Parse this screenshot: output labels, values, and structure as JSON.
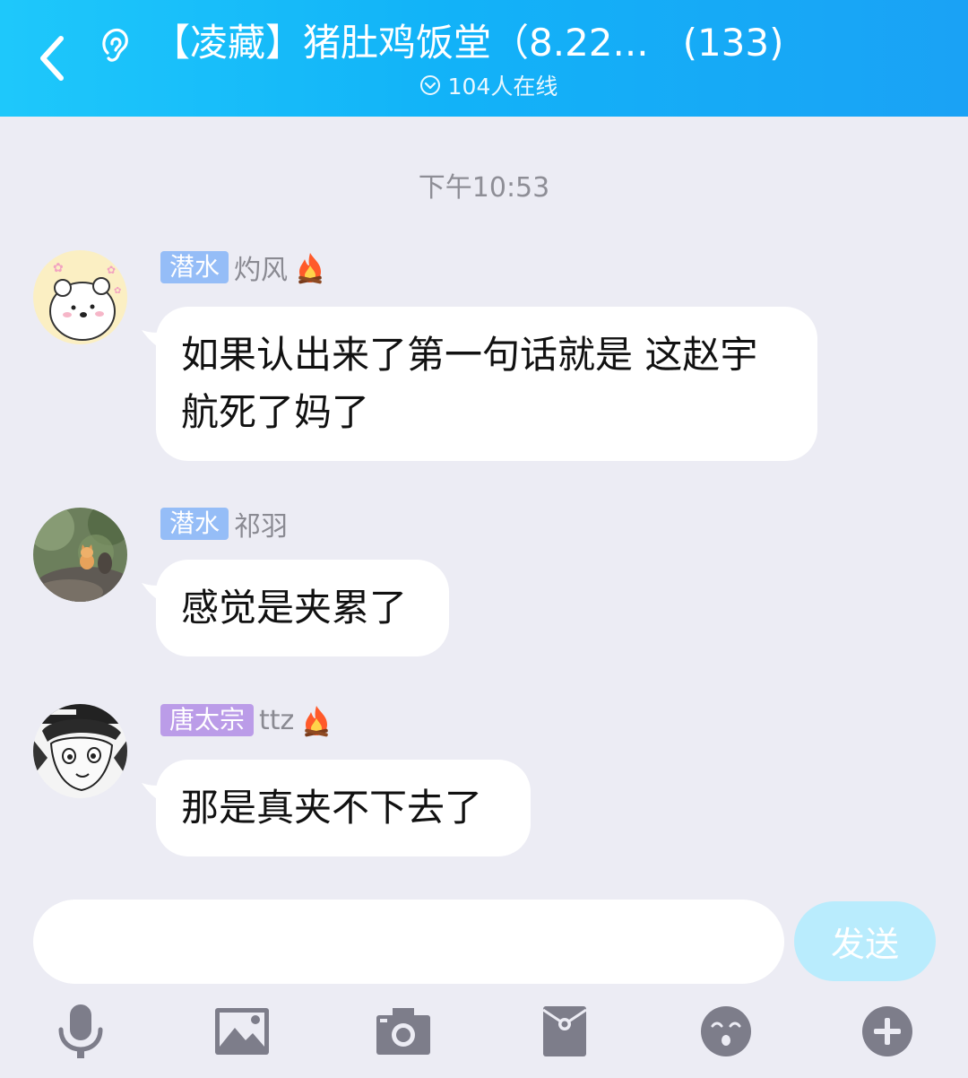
{
  "header": {
    "title": "【凌藏】猪肚鸡饭堂（8.22...",
    "member_count": "(133)",
    "online_text": "104人在线"
  },
  "chat": {
    "timestamp": "下午10:53",
    "messages": [
      {
        "badge": "潜水",
        "badge_color": "#95bdf7",
        "nickname": "灼风",
        "has_fire": true,
        "text": "如果认出来了第一句话就是  这赵宇航死了妈了",
        "avatar": "white-bear-avatar"
      },
      {
        "badge": "潜水",
        "badge_color": "#95bdf7",
        "nickname": "祁羽",
        "has_fire": false,
        "text": "感觉是夹累了",
        "avatar": "kitten-on-rock-avatar"
      },
      {
        "badge": "唐太宗",
        "badge_color": "#bb9ce8",
        "nickname": "ttz",
        "has_fire": true,
        "text": "那是真夹不下去了",
        "avatar": "manga-boy-avatar"
      }
    ]
  },
  "composer": {
    "input_value": "",
    "send_label": "发送"
  },
  "toolbar": {
    "icons": [
      "microphone-icon",
      "image-icon",
      "camera-icon",
      "red-packet-icon",
      "emoji-icon",
      "plus-icon"
    ]
  },
  "colors": {
    "header_start": "#1ec8fb",
    "header_end": "#1aa2f5",
    "background": "#ececf4",
    "send_button": "#b9ecfd",
    "toolbar_icon": "#7d7d8a"
  }
}
